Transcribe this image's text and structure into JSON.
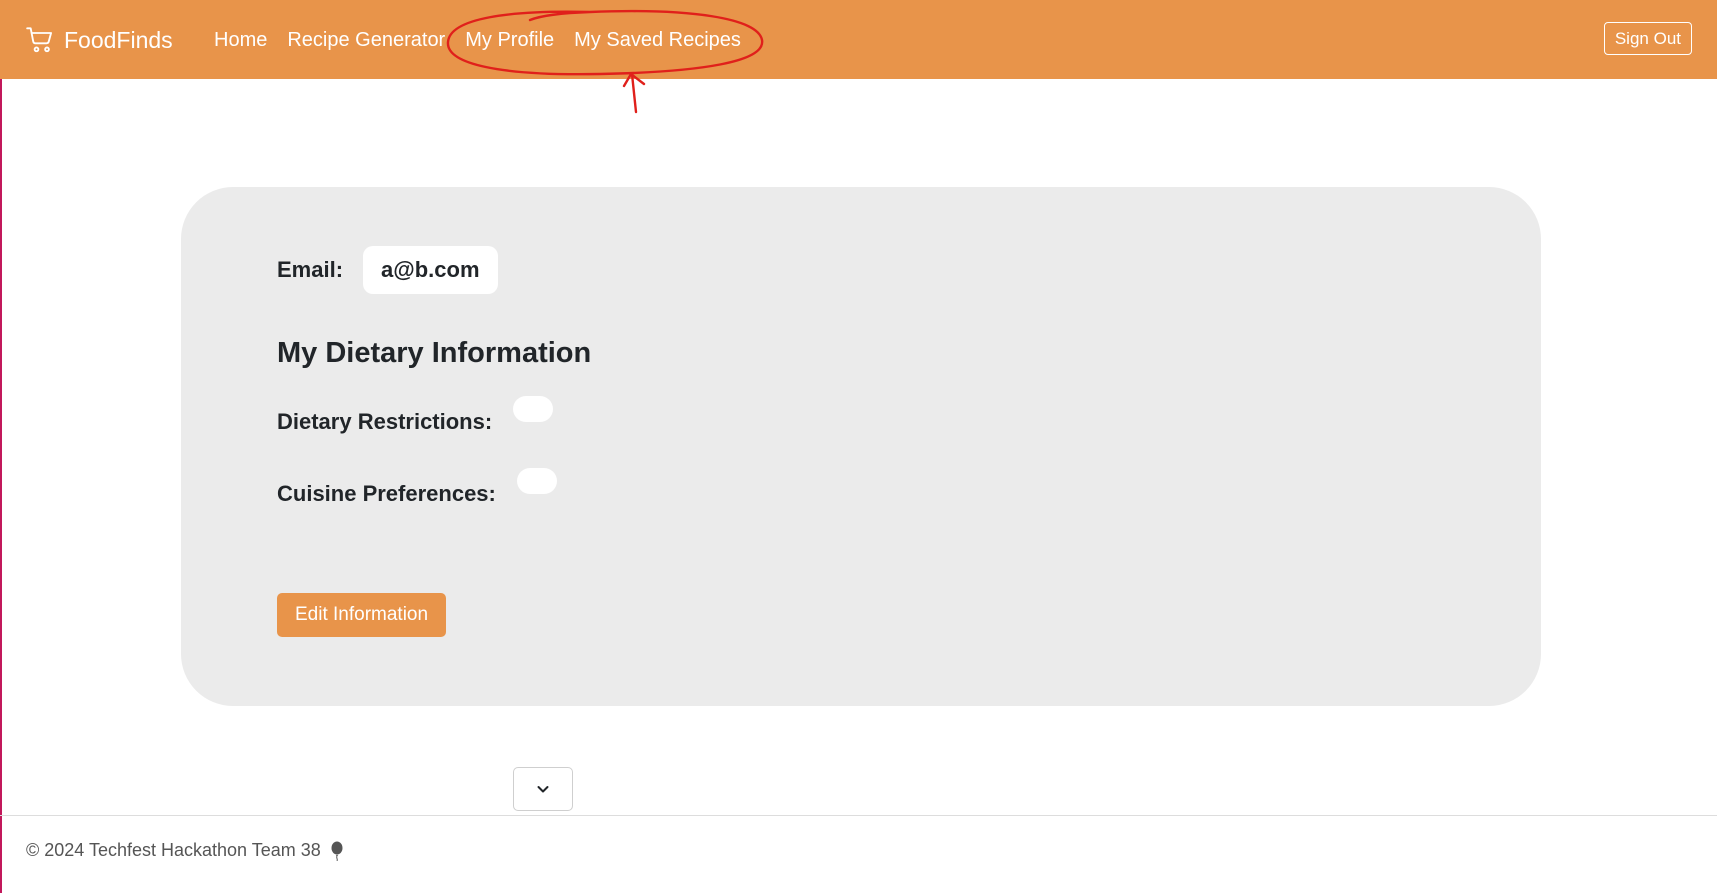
{
  "colors": {
    "accent": "#e8944a",
    "card_bg": "#ebebeb",
    "annotation_red": "#e0201b"
  },
  "navbar": {
    "brand_icon": "cart-icon",
    "brand": "FoodFinds",
    "links": [
      {
        "label": "Home"
      },
      {
        "label": "Recipe Generator"
      },
      {
        "label": "My Profile"
      },
      {
        "label": "My Saved Recipes"
      }
    ],
    "sign_out": "Sign Out"
  },
  "profile": {
    "email_label": "Email:",
    "email_value": "a@b.com",
    "section_title": "My Dietary Information",
    "dietary_label": "Dietary Restrictions:",
    "dietary_value": "",
    "cuisine_label": "Cuisine Preferences:",
    "cuisine_value": "",
    "edit_button": "Edit Information"
  },
  "dropdown_icon": "chevron-down-icon",
  "footer": {
    "text": "© 2024 Techfest Hackathon Team 38",
    "icon": "balloon-icon"
  }
}
